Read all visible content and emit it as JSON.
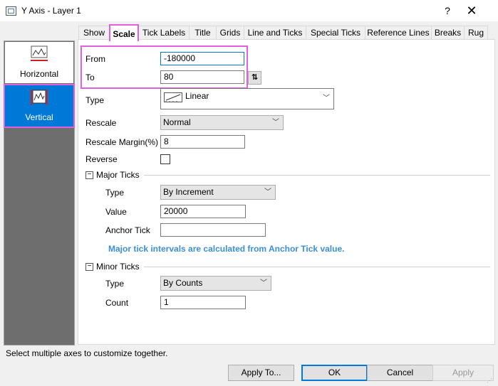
{
  "window": {
    "title": "Y Axis - Layer 1",
    "help_glyph": "?",
    "close_glyph": "✕"
  },
  "axes": {
    "items": [
      {
        "label": "Horizontal"
      },
      {
        "label": "Vertical"
      }
    ]
  },
  "tabs": [
    "Show",
    "Scale",
    "Tick Labels",
    "Title",
    "Grids",
    "Line and Ticks",
    "Special Ticks",
    "Reference Lines",
    "Breaks",
    "Rug"
  ],
  "scale": {
    "from_label": "From",
    "from_value": "-180000",
    "to_label": "To",
    "to_value": "80",
    "swap_glyph": "⇅",
    "type_label": "Type",
    "type_value": "Linear",
    "rescale_label": "Rescale",
    "rescale_value": "Normal",
    "rescale_margin_label": "Rescale Margin(%)",
    "rescale_margin_value": "8",
    "reverse_label": "Reverse"
  },
  "major_ticks": {
    "header": "Major Ticks",
    "collapse_glyph": "−",
    "type_label": "Type",
    "type_value": "By Increment",
    "value_label": "Value",
    "value_value": "20000",
    "anchor_label": "Anchor Tick",
    "anchor_value": "",
    "note": "Major tick intervals are calculated from Anchor Tick value."
  },
  "minor_ticks": {
    "header": "Minor Ticks",
    "collapse_glyph": "−",
    "type_label": "Type",
    "type_value": "By Counts",
    "count_label": "Count",
    "count_value": "1"
  },
  "status_text": "Select multiple axes to customize together.",
  "buttons": {
    "apply_to": "Apply To...",
    "ok": "OK",
    "cancel": "Cancel",
    "apply": "Apply"
  },
  "colors": {
    "accent": "#0078d7",
    "highlight": "#e060e0",
    "note": "#3b8fd9"
  }
}
